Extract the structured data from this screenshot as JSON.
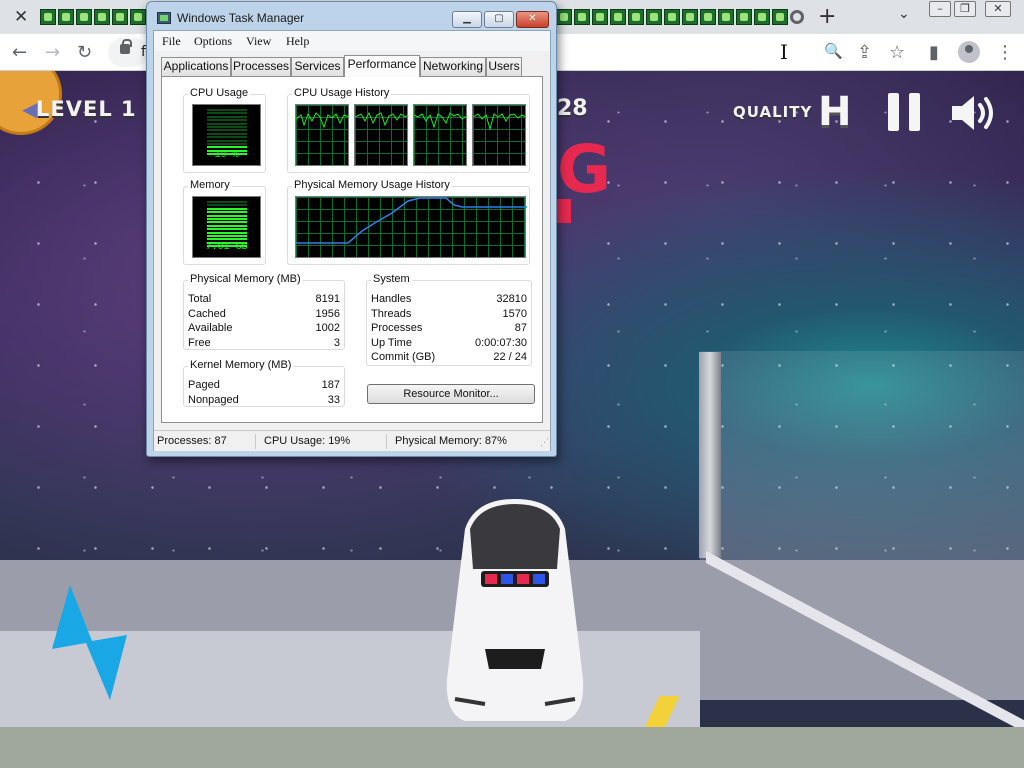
{
  "browser": {
    "tab_close": "✕",
    "new_tab": "+",
    "tab_list": "⌄",
    "url_fragment": "f",
    "nav": {
      "back": "←",
      "forward": "→",
      "reload": "↻"
    },
    "toolbar_icons": {
      "zoom": "🔍",
      "share": "⇪",
      "bookmark": "☆",
      "side_panel": "▮",
      "menu": "⋮"
    },
    "window_buttons": {
      "minimize": "–",
      "restore": "❐",
      "close": "✕"
    }
  },
  "game": {
    "level_label": "LEVEL 1",
    "score_fragment": "28",
    "banner_fragment": "G",
    "quality_label": "QUALITY",
    "quality_value": "H",
    "colors": {
      "banner": "#e8294f",
      "back_button": "#e8a23a",
      "bolt": "#1aa7e6"
    }
  },
  "task_manager": {
    "title": "Windows Task Manager",
    "caption_buttons": {
      "minimize": "▁",
      "maximize": "▢",
      "close": "✕"
    },
    "menu": [
      "File",
      "Options",
      "View",
      "Help"
    ],
    "tabs": [
      "Applications",
      "Processes",
      "Services",
      "Performance",
      "Networking",
      "Users"
    ],
    "active_tab": "Performance",
    "cpu_usage": {
      "label": "CPU Usage",
      "value": "19 %",
      "fraction": 0.19
    },
    "cpu_history": {
      "label": "CPU Usage History",
      "cores": 4
    },
    "memory": {
      "label": "Memory",
      "value": "7.01 GB",
      "fraction": 0.87
    },
    "memory_history": {
      "label": "Physical Memory Usage History"
    },
    "physical_memory": {
      "label": "Physical Memory (MB)",
      "rows": [
        {
          "key": "Total",
          "value": "8191"
        },
        {
          "key": "Cached",
          "value": "1956"
        },
        {
          "key": "Available",
          "value": "1002"
        },
        {
          "key": "Free",
          "value": "3"
        }
      ]
    },
    "kernel_memory": {
      "label": "Kernel Memory (MB)",
      "rows": [
        {
          "key": "Paged",
          "value": "187"
        },
        {
          "key": "Nonpaged",
          "value": "33"
        }
      ]
    },
    "system": {
      "label": "System",
      "rows": [
        {
          "key": "Handles",
          "value": "32810"
        },
        {
          "key": "Threads",
          "value": "1570"
        },
        {
          "key": "Processes",
          "value": "87"
        },
        {
          "key": "Up Time",
          "value": "0:00:07:30"
        },
        {
          "key": "Commit (GB)",
          "value": "22 / 24"
        }
      ]
    },
    "resource_monitor_button": "Resource Monitor...",
    "status": {
      "processes": "Processes: 87",
      "cpu": "CPU Usage: 19%",
      "memory": "Physical Memory: 87%"
    },
    "colors": {
      "graph_line": "#21e621",
      "memory_line": "#2f7fe8",
      "grid": "#0a6b33"
    }
  }
}
